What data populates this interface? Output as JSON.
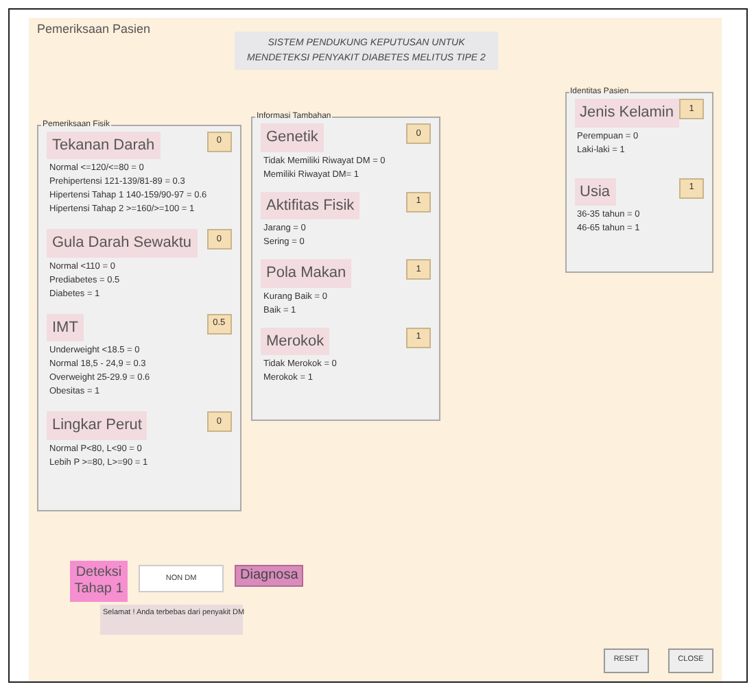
{
  "window": {
    "title": "Pemeriksaan Pasien"
  },
  "header": "SISTEM PENDUKUNG KEPUTUSAN UNTUK MENDETEKSI PENYAKIT DIABETES MELITUS TIPE 2",
  "panels": [
    {
      "legend": "Pemeriksaan Fisik",
      "sections": [
        {
          "title": "Tekanan Darah",
          "value": "0",
          "rules": [
            "Normal <=120/<=80 = 0",
            "Prehipertensi 121-139/81-89 = 0.3",
            "Hipertensi Tahap 1 140-159/90-97 = 0.6",
            "Hipertensi Tahap 2 >=160/>=100 = 1"
          ]
        },
        {
          "title": "Gula Darah Sewaktu",
          "value": "0",
          "rules": [
            "Normal <110 = 0",
            "Prediabetes = 0.5",
            "Diabetes = 1"
          ]
        },
        {
          "title": "IMT",
          "value": "0.5",
          "rules": [
            "Underweight <18.5 = 0",
            "Normal 18,5 - 24,9 = 0.3",
            "Overweight 25-29.9 = 0.6",
            "Obesitas = 1"
          ]
        },
        {
          "title": "Lingkar Perut",
          "value": "0",
          "rules": [
            "Normal P<80, L<90 = 0",
            "Lebih P >=80, L>=90 = 1"
          ]
        }
      ]
    },
    {
      "legend": "Informasi Tambahan",
      "sections": [
        {
          "title": "Genetik",
          "value": "0",
          "rules": [
            "Tidak Memiliki Riwayat DM = 0",
            "Memiliki Riwayat DM= 1"
          ]
        },
        {
          "title": "Aktifitas Fisik",
          "value": "1",
          "rules": [
            "Jarang = 0",
            "Sering = 0"
          ]
        },
        {
          "title": "Pola Makan",
          "value": "1",
          "rules": [
            "Kurang Baik = 0",
            "Baik = 1"
          ]
        },
        {
          "title": "Merokok",
          "value": "1",
          "rules": [
            "Tidak Merokok = 0",
            "Merokok = 1"
          ]
        }
      ]
    },
    {
      "legend": "Identitas Pasien",
      "sections": [
        {
          "title": "Jenis Kelamin",
          "value": "1",
          "rules": [
            "Perempuan = 0",
            "Laki-laki = 1"
          ]
        },
        {
          "title": "Usia",
          "value": "1",
          "rules": [
            "36-35 tahun = 0",
            "46-65 tahun = 1"
          ]
        }
      ]
    }
  ],
  "detection": {
    "label": "Deteksi Tahap 1",
    "result": "NON DM",
    "button": "Diagnosa",
    "message": "Selamat ! Anda terbebas dari penyakit DM"
  },
  "buttons": [
    "RESET",
    "CLOSE"
  ]
}
